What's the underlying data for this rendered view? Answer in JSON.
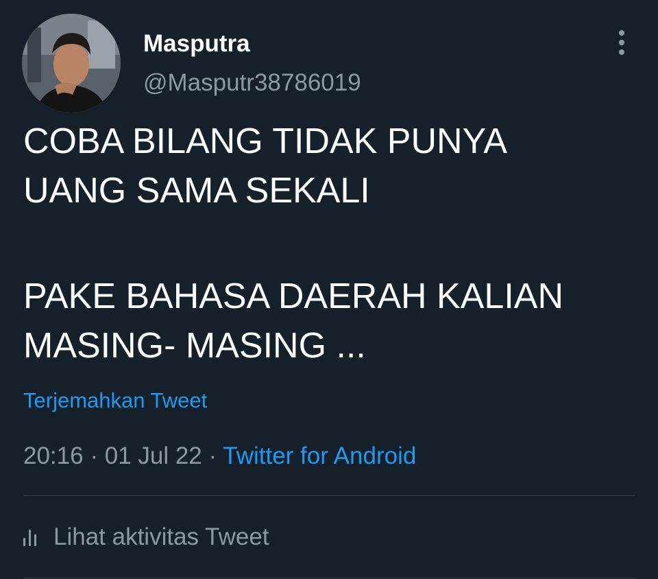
{
  "user": {
    "display_name": "Masputra",
    "handle": "@Masputr38786019"
  },
  "tweet": {
    "lines": [
      "COBA BILANG TIDAK PUNYA",
      "UANG SAMA SEKALI",
      "PAKE BAHASA DAERAH KALIAN",
      "MASING- MASING ..."
    ],
    "translate_label": "Terjemahkan Tweet",
    "time": "20:16",
    "separator": " · ",
    "date": "01 Jul 22",
    "source": "Twitter for Android",
    "activity_label": "Lihat aktivitas Tweet"
  },
  "icons": {
    "more": "more-vertical-icon",
    "activity": "bar-chart-icon"
  },
  "colors": {
    "background": "#15202b",
    "primary_text": "#ffffff",
    "secondary_text": "#8b98a5",
    "link": "#1d9bf0",
    "divider": "#38444d"
  }
}
